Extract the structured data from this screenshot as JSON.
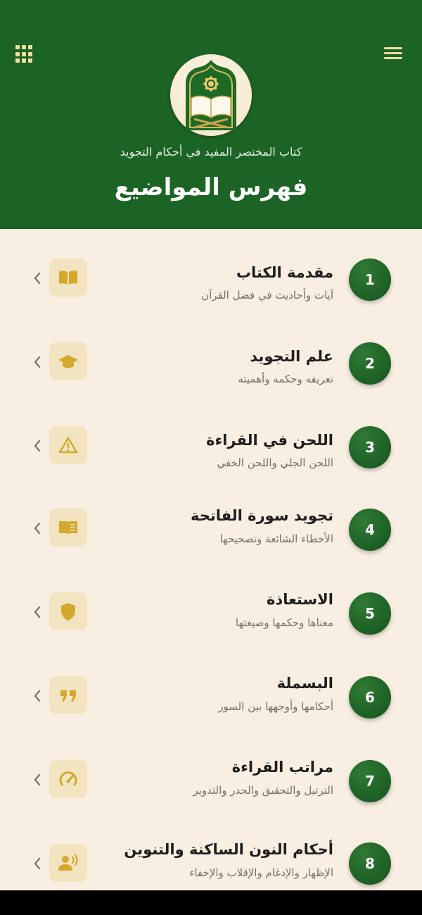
{
  "header": {
    "subtitle": "كتاب المختصر المفيد في أحكام التجويد",
    "title": "فهرس المواضيع",
    "grid_icon": "grid-icon",
    "menu_icon": "hamburger-menu-icon",
    "logo_icon": "quran-book-icon"
  },
  "colors": {
    "header_bg": "#1c6425",
    "page_bg": "#f8eee2",
    "accent_gold": "#d4a82c",
    "icon_box_bg": "#f3e4c1"
  },
  "topics": [
    {
      "num": "1",
      "title": "مقدمة الكتاب",
      "subtitle": "آيات وأحاديث في فضل القرآن",
      "icon": "open-book-icon"
    },
    {
      "num": "2",
      "title": "علم التجويد",
      "subtitle": "تعريفه وحكمه وأهميته",
      "icon": "graduation-cap-icon"
    },
    {
      "num": "3",
      "title": "اللحن في القراءة",
      "subtitle": "اللحن الجلي واللحن الخفي",
      "icon": "warning-icon"
    },
    {
      "num": "4",
      "title": "تجويد سورة الفاتحة",
      "subtitle": "الأخطاء الشائعة وتصحيحها",
      "icon": "book-reader-icon"
    },
    {
      "num": "5",
      "title": "الاستعاذة",
      "subtitle": "معناها وحكمها وصيغتها",
      "icon": "shield-icon"
    },
    {
      "num": "6",
      "title": "البسملة",
      "subtitle": "أحكامها وأوجهها بين السور",
      "icon": "quote-icon"
    },
    {
      "num": "7",
      "title": "مراتب القراءة",
      "subtitle": "الترتيل والتحقيق والحدر والتدوير",
      "icon": "speedometer-icon"
    },
    {
      "num": "8",
      "title": "أحكام النون الساكنة والتنوين",
      "subtitle": "الإظهار والإدغام والإقلاب والإخفاء",
      "icon": "speaking-person-icon"
    }
  ]
}
